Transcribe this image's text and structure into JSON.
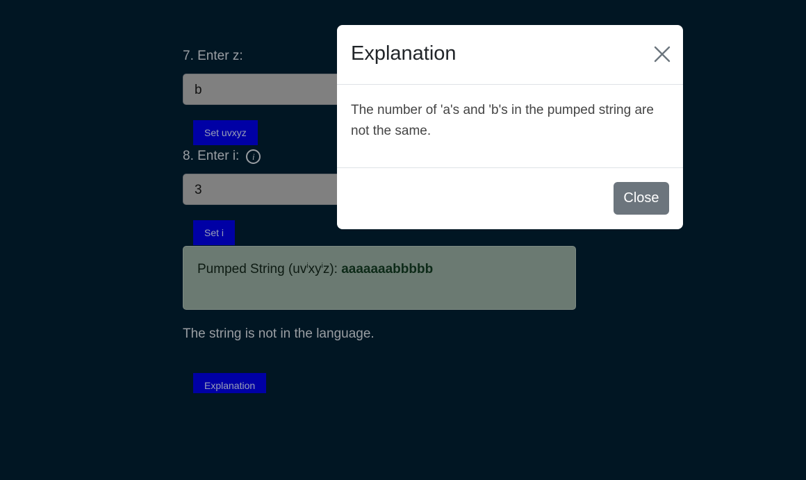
{
  "form": {
    "step7_label": "7. Enter z:",
    "z_value": "b",
    "set_uvxyz_label": "Set uvxyz",
    "step8_label": "8. Enter i:",
    "info_icon_glyph": "i",
    "i_value": "3",
    "set_i_label": "Set i"
  },
  "result": {
    "label_prefix": "Pumped String (uv",
    "sup1": "i",
    "label_mid": "xy",
    "sup2": "i",
    "label_suffix": "z): ",
    "value": "aaaaaaabbbbb",
    "status": "The string is not in the language.",
    "explanation_button": "Explanation"
  },
  "modal": {
    "title": "Explanation",
    "body": "The number of 'a's and 'b's in the pumped string are not the same.",
    "close_label": "Close"
  },
  "icons": {
    "info": "info-circle-icon",
    "close": "close-x-icon"
  }
}
